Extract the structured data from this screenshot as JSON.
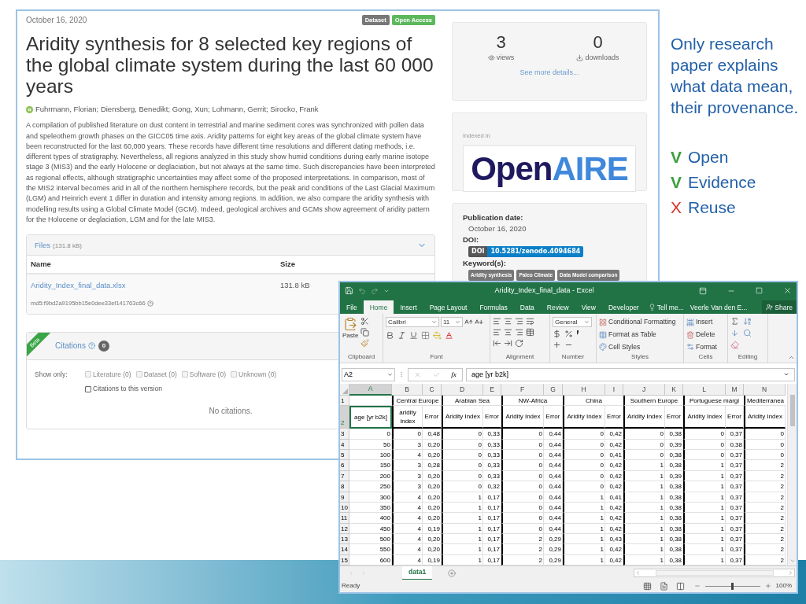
{
  "web_page": {
    "date": "October 16, 2020",
    "badges": [
      {
        "label": "Dataset",
        "kind": "type"
      },
      {
        "label": "Open Access",
        "kind": "access"
      }
    ],
    "title": "Aridity synthesis for 8 selected key regions of the global climate system during the last 60 000 years",
    "authors": "Fuhrmann, Florian; Diensberg, Benedikt; Gong, Xun; Lohmann, Gerrit; Sirocko, Frank",
    "abstract": "A compilation of published literature on dust content in terrestrial and marine sediment cores was synchronized with pollen data and speleothem growth phases on the GICC05 time axis. Aridity patterns for eight key areas of the global climate system have been reconstructed for the last 60,000 years. These records have different time resolutions and different dating methods, i.e. different types of stratigraphy. Nevertheless, all regions analyzed in this study show humid conditions during early marine isotope stage 3 (MIS3) and the early Holocene or deglaciation, but not always at the same time. Such discrepancies have been interpreted as regional effects, although stratigraphic uncertainties may affect some of the proposed interpretations. In comparison, most of the MIS2 interval becomes arid in all of the northern hemisphere records, but the peak arid conditions of the Last Glacial Maximum (LGM) and Heinrich event 1 differ in duration and intensity among regions. In addition, we also compare the aridity synthesis with modelling results using a Global Climate Model (GCM). Indeed, geological archives and GCMs show agreement of aridity pattern for the Holocene or deglaciation, LGM and for the late MIS3.",
    "files": {
      "title": "Files",
      "size": "(131.8 kB)",
      "expanded": true,
      "columns": [
        "Name",
        "Size"
      ],
      "rows": [
        {
          "name": "Aridity_Index_final_data.xlsx",
          "size": "131.8 kB",
          "checksum": "md5:f9bd2a9195bb15e0dee33ef141763c66"
        }
      ]
    },
    "citations": {
      "ribbon": "Beta",
      "title": "Citations",
      "count": "0",
      "filter_label": "Show only:",
      "filters": [
        {
          "label": "Literature (0)",
          "checked": false,
          "disabled": true
        },
        {
          "label": "Dataset (0)",
          "checked": false,
          "disabled": true
        },
        {
          "label": "Software (0)",
          "checked": false,
          "disabled": true
        },
        {
          "label": "Unknown (0)",
          "checked": false,
          "disabled": true
        },
        {
          "label": "Citations to this version",
          "checked": false,
          "disabled": false
        }
      ],
      "empty": "No citations."
    },
    "sidebar": {
      "views": "3",
      "views_label": "views",
      "downloads": "0",
      "downloads_label": "downloads",
      "details_link": "See more details...",
      "indexed_label": "Indexed in",
      "logo": [
        "Open",
        "AIRE"
      ],
      "publication_date_label": "Publication date:",
      "publication_date": "October 16, 2020",
      "doi_label": "DOI:",
      "doi_prefix": "DOI",
      "doi": "10.5281/zenodo.4094684",
      "keywords_label": "Keyword(s):",
      "keywords": [
        "Aridity synthesis",
        "Paleo Climate",
        "Data Model comparison"
      ]
    }
  },
  "notes": {
    "text": "Only research paper explains what data mean, their provenance.",
    "checks": [
      {
        "mark": "V",
        "label": "Open",
        "kind": "yes"
      },
      {
        "mark": "V",
        "label": "Evidence",
        "kind": "yes"
      },
      {
        "mark": "X",
        "label": "Reuse",
        "kind": "no"
      }
    ]
  },
  "excel": {
    "title": "Aridity_Index_final_data - Excel",
    "tabs": [
      {
        "label": "File",
        "selected": false
      },
      {
        "label": "Home",
        "selected": true
      },
      {
        "label": "Insert",
        "selected": false
      },
      {
        "label": "Page Layout",
        "selected": false
      },
      {
        "label": "Formulas",
        "selected": false
      },
      {
        "label": "Data",
        "selected": false
      },
      {
        "label": "Review",
        "selected": false
      },
      {
        "label": "View",
        "selected": false
      },
      {
        "label": "Developer",
        "selected": false
      }
    ],
    "tell_me": "Tell me...",
    "user": "Veerle Van den E...",
    "share": "Share",
    "ribbon": {
      "paste": "Paste",
      "font_name": "Calibri",
      "font_size": "11",
      "number_format": "General",
      "styles": [
        "Conditional Formatting",
        "Format as Table",
        "Cell Styles"
      ],
      "cells": [
        "Insert",
        "Delete",
        "Format"
      ],
      "groups": [
        "Clipboard",
        "Font",
        "Alignment",
        "Number",
        "Styles",
        "Cells",
        "Editing"
      ]
    },
    "name_box": "A2",
    "function_label": "fx",
    "formula": "age [yr b2k]",
    "columns": [
      {
        "label": "A",
        "selected": true
      },
      {
        "label": "B",
        "selected": false
      },
      {
        "label": "C",
        "selected": false
      },
      {
        "label": "D",
        "selected": false
      },
      {
        "label": "E",
        "selected": false
      },
      {
        "label": "F",
        "selected": false
      },
      {
        "label": "G",
        "selected": false
      },
      {
        "label": "H",
        "selected": false
      },
      {
        "label": "I",
        "selected": false
      },
      {
        "label": "J",
        "selected": false
      },
      {
        "label": "K",
        "selected": false
      },
      {
        "label": "L",
        "selected": false
      },
      {
        "label": "M",
        "selected": false
      },
      {
        "label": "N",
        "selected": false
      }
    ],
    "region_row": {
      "number": "1",
      "labels": [
        "Central Europe",
        "Arabian Sea",
        "NW-Africa",
        "China",
        "Southern Europe",
        "Portuguese margi",
        "Mediterranea"
      ]
    },
    "header_row": {
      "number": "2",
      "selected": true,
      "cells": [
        {
          "text": "age [yr b2k]",
          "selected": true
        },
        {
          "text": "aridity index",
          "selected": false
        },
        {
          "text": "Error",
          "selected": false
        },
        {
          "text": "Aridity Index",
          "selected": false
        },
        {
          "text": "Error",
          "selected": false
        },
        {
          "text": "Aridity Index",
          "selected": false
        },
        {
          "text": "Error",
          "selected": false
        },
        {
          "text": "Aridity Index",
          "selected": false
        },
        {
          "text": "Error",
          "selected": false
        },
        {
          "text": "Aridity Index",
          "selected": false
        },
        {
          "text": "Error",
          "selected": false
        },
        {
          "text": "Aridity Index",
          "selected": false
        },
        {
          "text": "Error",
          "selected": false
        },
        {
          "text": "Aridity Index",
          "selected": false
        }
      ]
    },
    "rows": [
      {
        "number": "3",
        "cells": [
          "0",
          "0",
          "0,48",
          "0",
          "0,33",
          "0",
          "0,44",
          "0",
          "0,42",
          "0",
          "0,38",
          "0",
          "0,37",
          "0"
        ]
      },
      {
        "number": "4",
        "cells": [
          "50",
          "3",
          "0,20",
          "0",
          "0,33",
          "0",
          "0,44",
          "0",
          "0,42",
          "0",
          "0,39",
          "0",
          "0,38",
          "0"
        ]
      },
      {
        "number": "5",
        "cells": [
          "100",
          "4",
          "0,20",
          "0",
          "0,33",
          "0",
          "0,44",
          "0",
          "0,41",
          "0",
          "0,38",
          "0",
          "0,37",
          "0"
        ]
      },
      {
        "number": "6",
        "cells": [
          "150",
          "3",
          "0,28",
          "0",
          "0,33",
          "0",
          "0,44",
          "0",
          "0,42",
          "1",
          "0,38",
          "1",
          "0,37",
          "2"
        ]
      },
      {
        "number": "7",
        "cells": [
          "200",
          "3",
          "0,20",
          "0",
          "0,33",
          "0",
          "0,44",
          "0",
          "0,42",
          "1",
          "0,39",
          "1",
          "0,37",
          "2"
        ]
      },
      {
        "number": "8",
        "cells": [
          "250",
          "3",
          "0,20",
          "0",
          "0,32",
          "0",
          "0,44",
          "0",
          "0,42",
          "1",
          "0,38",
          "1",
          "0,37",
          "2"
        ]
      },
      {
        "number": "9",
        "cells": [
          "300",
          "4",
          "0,20",
          "1",
          "0,17",
          "0",
          "0,44",
          "1",
          "0,41",
          "1",
          "0,38",
          "1",
          "0,37",
          "2"
        ]
      },
      {
        "number": "10",
        "cells": [
          "350",
          "4",
          "0,20",
          "1",
          "0,17",
          "0",
          "0,44",
          "1",
          "0,42",
          "1",
          "0,38",
          "1",
          "0,37",
          "2"
        ]
      },
      {
        "number": "11",
        "cells": [
          "400",
          "4",
          "0,20",
          "1",
          "0,17",
          "0",
          "0,44",
          "1",
          "0,42",
          "1",
          "0,38",
          "1",
          "0,37",
          "2"
        ]
      },
      {
        "number": "12",
        "cells": [
          "450",
          "4",
          "0,19",
          "1",
          "0,17",
          "0",
          "0,44",
          "1",
          "0,42",
          "1",
          "0,38",
          "1",
          "0,37",
          "2"
        ]
      },
      {
        "number": "13",
        "cells": [
          "500",
          "4",
          "0,20",
          "1",
          "0,17",
          "2",
          "0,29",
          "1",
          "0,43",
          "1",
          "0,38",
          "1",
          "0,37",
          "2"
        ]
      },
      {
        "number": "14",
        "cells": [
          "550",
          "4",
          "0,20",
          "1",
          "0,17",
          "2",
          "0,29",
          "1",
          "0,42",
          "1",
          "0,38",
          "1",
          "0,37",
          "2"
        ]
      },
      {
        "number": "15",
        "cells": [
          "600",
          "4",
          "0,19",
          "1",
          "0,17",
          "2",
          "0,29",
          "1",
          "0,42",
          "1",
          "0,38",
          "1",
          "0,37",
          "2"
        ]
      }
    ],
    "sheets": [
      {
        "label": "data1",
        "selected": true
      }
    ],
    "status": "Ready",
    "zoom": {
      "level": 0.5,
      "reading": "100%"
    }
  }
}
